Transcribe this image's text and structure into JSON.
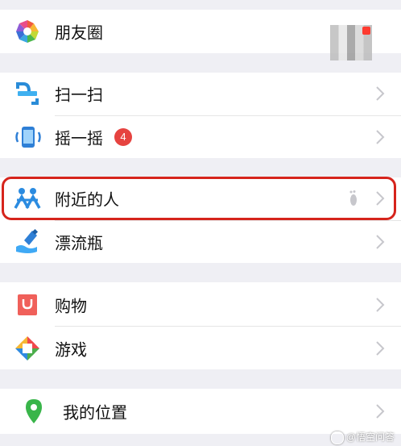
{
  "groups": [
    {
      "items": [
        {
          "label": "朋友圈"
        }
      ]
    },
    {
      "items": [
        {
          "label": "扫一扫"
        },
        {
          "label": "摇一摇",
          "badge": "4"
        }
      ]
    },
    {
      "items": [
        {
          "label": "附近的人"
        },
        {
          "label": "漂流瓶"
        }
      ]
    },
    {
      "items": [
        {
          "label": "购物"
        },
        {
          "label": "游戏"
        }
      ]
    },
    {
      "items": [
        {
          "label": "我的位置"
        }
      ]
    }
  ],
  "watermark": "@悟空问答",
  "colors": {
    "highlight": "#d6241c",
    "badge": "#e64340",
    "background": "#efeff4"
  },
  "icons": [
    "moments-icon",
    "scan-icon",
    "shake-icon",
    "people-nearby-icon",
    "drift-bottle-icon",
    "shopping-icon",
    "games-icon",
    "location-icon"
  ]
}
